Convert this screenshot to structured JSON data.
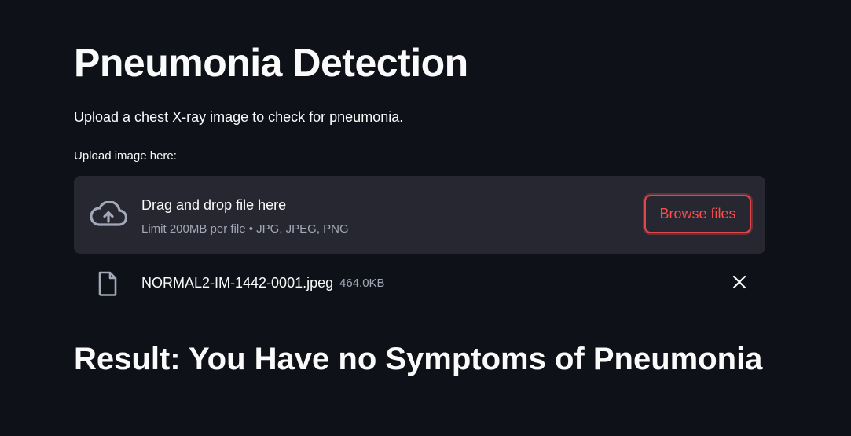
{
  "page": {
    "title": "Pneumonia Detection",
    "subtitle": "Upload a chest X-ray image to check for pneumonia."
  },
  "uploader": {
    "label": "Upload image here:",
    "dropzone_title": "Drag and drop file here",
    "dropzone_limit": "Limit 200MB per file • JPG, JPEG, PNG",
    "browse_label": "Browse files",
    "icon": "cloud-upload-icon"
  },
  "uploaded_file": {
    "name": "NORMAL2-IM-1442-0001.jpeg",
    "size": "464.0KB",
    "icon": "file-icon",
    "remove_icon": "close-icon"
  },
  "result": {
    "text": "Result: You Have no Symptoms of Pneumonia"
  },
  "colors": {
    "background": "#0e1117",
    "dropzone": "#262730",
    "accent": "#ff4b4b",
    "text": "#fafafa",
    "muted": "#a3a8b8"
  }
}
